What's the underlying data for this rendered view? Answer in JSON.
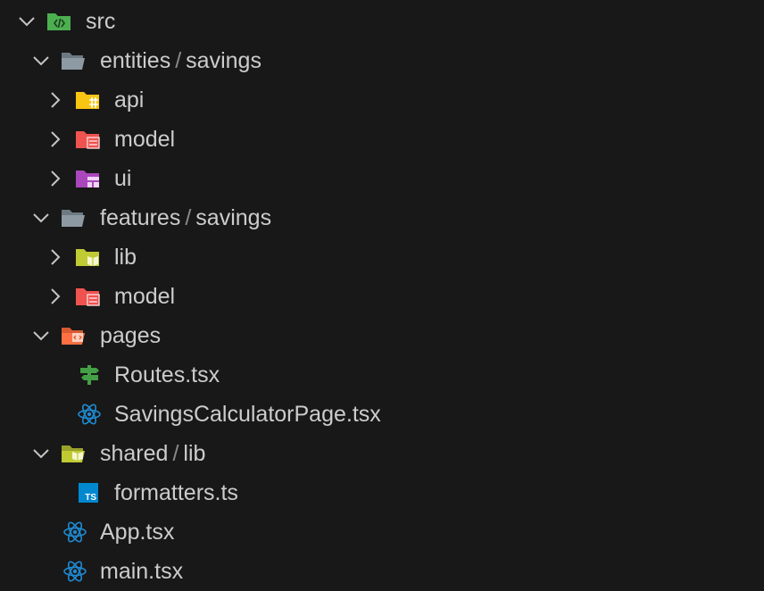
{
  "explorer": {
    "items": [
      {
        "name": "src",
        "kind": "folder-open",
        "icon": "folder-src-icon"
      },
      {
        "name": "entities",
        "sub": "savings",
        "kind": "folder-open",
        "icon": "folder-open-icon"
      },
      {
        "name": "api",
        "kind": "folder-collapsed",
        "icon": "folder-api-icon"
      },
      {
        "name": "model",
        "kind": "folder-collapsed",
        "icon": "folder-model-icon"
      },
      {
        "name": "ui",
        "kind": "folder-collapsed",
        "icon": "folder-ui-icon"
      },
      {
        "name": "features",
        "sub": "savings",
        "kind": "folder-open",
        "icon": "folder-open-icon"
      },
      {
        "name": "lib",
        "kind": "folder-collapsed",
        "icon": "folder-lib-icon"
      },
      {
        "name": "model",
        "kind": "folder-collapsed",
        "icon": "folder-model-icon"
      },
      {
        "name": "pages",
        "kind": "folder-open",
        "icon": "folder-pages-icon"
      },
      {
        "name": "Routes.tsx",
        "kind": "file",
        "icon": "routes-file-icon"
      },
      {
        "name": "SavingsCalculatorPage.tsx",
        "kind": "file",
        "icon": "react-file-icon"
      },
      {
        "name": "shared",
        "sub": "lib",
        "kind": "folder-open",
        "icon": "folder-lib-open-icon"
      },
      {
        "name": "formatters.ts",
        "kind": "file",
        "icon": "typescript-file-icon"
      },
      {
        "name": "App.tsx",
        "kind": "file",
        "icon": "react-file-icon"
      },
      {
        "name": "main.tsx",
        "kind": "file",
        "icon": "react-file-icon"
      }
    ],
    "separator": "/",
    "ts_badge": "TS"
  },
  "colors": {
    "background": "#181818",
    "text": "#cccccc",
    "folder_gray": "#8e9aa3",
    "folder_src_green": "#4caf50",
    "folder_api_yellow": "#f9c513",
    "folder_model_red": "#ef5350",
    "folder_ui_purple": "#ab47bc",
    "folder_lib_green": "#c0ca33",
    "folder_pages_orange": "#ff7043",
    "react_blue": "#1f8ad2",
    "routes_green": "#43a047",
    "ts_blue": "#0288d1"
  }
}
